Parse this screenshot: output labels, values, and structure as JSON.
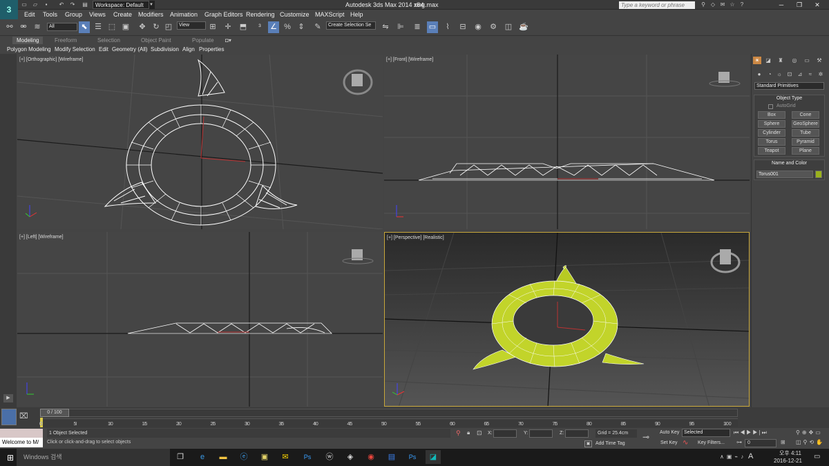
{
  "titlebar": {
    "workspace": "Workspace: Default",
    "app_title": "Autodesk 3ds Max  2014 x64",
    "filename": "ring.max",
    "search_placeholder": "Type a keyword or phrase"
  },
  "menu": [
    "Edit",
    "Tools",
    "Group",
    "Views",
    "Create",
    "Modifiers",
    "Animation",
    "Graph Editors",
    "Rendering",
    "Customize",
    "MAXScript",
    "Help"
  ],
  "toolbar": {
    "filter_value": "All",
    "coord_value": "View",
    "selection_set": "Create Selection Se"
  },
  "ribbon": {
    "tabs": [
      "Modeling",
      "Freeform",
      "Selection",
      "Object Paint",
      "Populate"
    ],
    "subtabs": [
      "Polygon Modeling",
      "Modify Selection",
      "Edit",
      "Geometry (All)",
      "Subdivision",
      "Align",
      "Properties"
    ]
  },
  "viewports": {
    "top_left": "[+] [Orthographic] [Wireframe]",
    "top_right": "[+] [Front] [Wireframe]",
    "bottom_left": "[+] [Left] [Wireframe]",
    "bottom_right": "[+] [Perspective] [Realistic]"
  },
  "command_panel": {
    "category": "Standard Primitives",
    "object_type_title": "Object Type",
    "autogrid": "AutoGrid",
    "buttons": [
      "Box",
      "Cone",
      "Sphere",
      "GeoSphere",
      "Cylinder",
      "Tube",
      "Torus",
      "Pyramid",
      "Teapot",
      "Plane"
    ],
    "name_color_title": "Name and Color",
    "object_name": "Torus001",
    "object_color": "#9ab21c"
  },
  "timeline": {
    "frame_display": "0 / 100",
    "ticks": [
      "0",
      "5",
      "10",
      "15",
      "20",
      "25",
      "30",
      "35",
      "40",
      "45",
      "50",
      "55",
      "60",
      "65",
      "70",
      "75",
      "80",
      "85",
      "90",
      "95",
      "100"
    ]
  },
  "status": {
    "maxscript": "Welcome to M/",
    "selected": "1 Object Selected",
    "prompt": "Click or click-and-drag to select objects",
    "x_label": "X:",
    "y_label": "Y:",
    "z_label": "Z:",
    "grid": "Grid = 25.4cm",
    "add_time_tag": "Add Time Tag",
    "auto_key": "Auto Key",
    "set_key": "Set Key",
    "key_mode": "Selected",
    "key_filters": "Key Filters...",
    "frame": "0"
  },
  "taskbar": {
    "search": "Windows 검색",
    "time": "오후 4:11",
    "date": "2016-12-21",
    "ime": "A"
  },
  "colors": {
    "accent": "#5a7fb8",
    "ring_fill": "#c2d42a",
    "timeslider": "#d8c84a"
  }
}
